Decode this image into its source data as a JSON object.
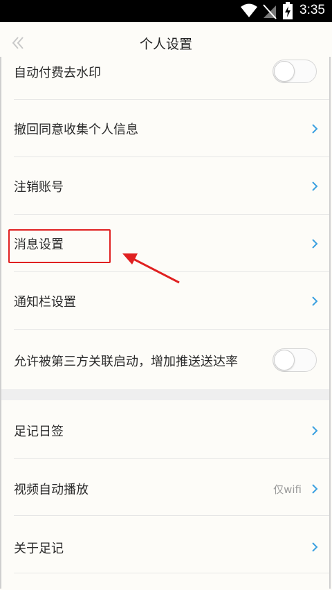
{
  "status_bar": {
    "time": "3:35"
  },
  "header": {
    "title": "个人设置"
  },
  "settings": {
    "auto_pay_watermark": "自动付费去水印",
    "revoke_consent": "撤回同意收集个人信息",
    "cancel_account": "注销账号",
    "message_settings": "消息设置",
    "notification_bar": "通知栏设置",
    "third_party_launch": "允许被第三方关联启动，增加推送送达率",
    "footprint_daily": "足记日签",
    "video_autoplay": "视频自动播放",
    "video_autoplay_value": "仅wifi",
    "about": "关于足记"
  },
  "toggles": {
    "auto_pay_watermark": false,
    "third_party_launch": false
  },
  "colors": {
    "accent": "#3aa0e0",
    "highlight": "#e02020",
    "background": "#fdfcf8"
  }
}
